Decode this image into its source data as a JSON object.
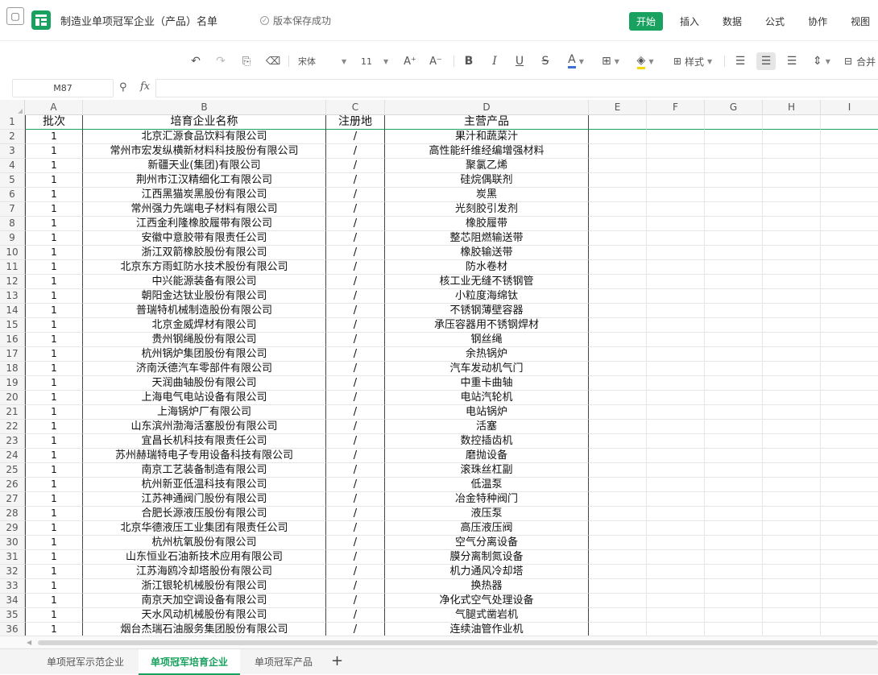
{
  "app": {
    "doc_title": "制造业单项冠军企业（产品）名单",
    "save_status": "版本保存成功",
    "menu": [
      "开始",
      "插入",
      "数据",
      "公式",
      "协作",
      "视图"
    ]
  },
  "toolbar": {
    "font_name": "宋体",
    "font_size": "11",
    "style_label": "样式",
    "merge_label": "合并"
  },
  "formula_bar": {
    "cell_ref": "M87",
    "fx_label": "fx",
    "value": ""
  },
  "columns": [
    "A",
    "B",
    "C",
    "D",
    "E",
    "F",
    "G",
    "H",
    "I"
  ],
  "header_row": {
    "num": "1",
    "cells": [
      "批次",
      "培育企业名称",
      "注册地",
      "主营产品"
    ]
  },
  "rows": [
    {
      "num": "2",
      "cells": [
        "1",
        "北京汇源食品饮料有限公司",
        "/",
        "果汁和蔬菜汁"
      ]
    },
    {
      "num": "3",
      "cells": [
        "1",
        "常州市宏发纵横新材料科技股份有限公司",
        "/",
        "高性能纤维经编增强材料"
      ]
    },
    {
      "num": "4",
      "cells": [
        "1",
        "新疆天业(集团)有限公司",
        "/",
        "聚氯乙烯"
      ]
    },
    {
      "num": "5",
      "cells": [
        "1",
        "荆州市江汉精细化工有限公司",
        "/",
        "硅烷偶联剂"
      ]
    },
    {
      "num": "6",
      "cells": [
        "1",
        "江西黑猫炭黑股份有限公司",
        "/",
        "炭黑"
      ]
    },
    {
      "num": "7",
      "cells": [
        "1",
        "常州强力先端电子材料有限公司",
        "/",
        "光刻胶引发剂"
      ]
    },
    {
      "num": "8",
      "cells": [
        "1",
        "江西金利隆橡胶履带有限公司",
        "/",
        "橡胶履带"
      ]
    },
    {
      "num": "9",
      "cells": [
        "1",
        "安徽中意胶带有限责任公司",
        "/",
        "整芯阻燃输送带"
      ]
    },
    {
      "num": "10",
      "cells": [
        "1",
        "浙江双箭橡胶股份有限公司",
        "/",
        "橡胶输送带"
      ]
    },
    {
      "num": "11",
      "cells": [
        "1",
        "北京东方雨虹防水技术股份有限公司",
        "/",
        "防水卷材"
      ]
    },
    {
      "num": "12",
      "cells": [
        "1",
        "中兴能源装备有限公司",
        "/",
        "核工业无缝不锈钢管"
      ]
    },
    {
      "num": "13",
      "cells": [
        "1",
        "朝阳金达钛业股份有限公司",
        "/",
        "小粒度海绵钛"
      ]
    },
    {
      "num": "14",
      "cells": [
        "1",
        "普瑞特机械制造股份有限公司",
        "/",
        "不锈钢薄壁容器"
      ]
    },
    {
      "num": "15",
      "cells": [
        "1",
        "北京金威焊材有限公司",
        "/",
        "承压容器用不锈钢焊材"
      ]
    },
    {
      "num": "16",
      "cells": [
        "1",
        "贵州钢绳股份有限公司",
        "/",
        "钢丝绳"
      ]
    },
    {
      "num": "17",
      "cells": [
        "1",
        "杭州锅炉集团股份有限公司",
        "/",
        "余热锅炉"
      ]
    },
    {
      "num": "18",
      "cells": [
        "1",
        "济南沃德汽车零部件有限公司",
        "/",
        "汽车发动机气门"
      ]
    },
    {
      "num": "19",
      "cells": [
        "1",
        "天润曲轴股份有限公司",
        "/",
        "中重卡曲轴"
      ]
    },
    {
      "num": "20",
      "cells": [
        "1",
        "上海电气电站设备有限公司",
        "/",
        "电站汽轮机"
      ]
    },
    {
      "num": "21",
      "cells": [
        "1",
        "上海锅炉厂有限公司",
        "/",
        "电站锅炉"
      ]
    },
    {
      "num": "22",
      "cells": [
        "1",
        "山东滨州渤海活塞股份有限公司",
        "/",
        "活塞"
      ]
    },
    {
      "num": "23",
      "cells": [
        "1",
        "宜昌长机科技有限责任公司",
        "/",
        "数控插齿机"
      ]
    },
    {
      "num": "24",
      "cells": [
        "1",
        "苏州赫瑞特电子专用设备科技有限公司",
        "/",
        "磨抛设备"
      ]
    },
    {
      "num": "25",
      "cells": [
        "1",
        "南京工艺装备制造有限公司",
        "/",
        "滚珠丝杠副"
      ]
    },
    {
      "num": "26",
      "cells": [
        "1",
        "杭州新亚低温科技有限公司",
        "/",
        "低温泵"
      ]
    },
    {
      "num": "27",
      "cells": [
        "1",
        "江苏神通阀门股份有限公司",
        "/",
        "冶金特种阀门"
      ]
    },
    {
      "num": "28",
      "cells": [
        "1",
        "合肥长源液压股份有限公司",
        "/",
        "液压泵"
      ]
    },
    {
      "num": "29",
      "cells": [
        "1",
        "北京华德液压工业集团有限责任公司",
        "/",
        "高压液压阀"
      ]
    },
    {
      "num": "30",
      "cells": [
        "1",
        "杭州杭氧股份有限公司",
        "/",
        "空气分离设备"
      ]
    },
    {
      "num": "31",
      "cells": [
        "1",
        "山东恒业石油新技术应用有限公司",
        "/",
        "膜分离制氮设备"
      ]
    },
    {
      "num": "32",
      "cells": [
        "1",
        "江苏海鸥冷却塔股份有限公司",
        "/",
        "机力通风冷却塔"
      ]
    },
    {
      "num": "33",
      "cells": [
        "1",
        "浙江银轮机械股份有限公司",
        "/",
        "换热器"
      ]
    },
    {
      "num": "34",
      "cells": [
        "1",
        "南京天加空调设备有限公司",
        "/",
        "净化式空气处理设备"
      ]
    },
    {
      "num": "35",
      "cells": [
        "1",
        "天水风动机械股份有限公司",
        "/",
        "气腿式凿岩机"
      ]
    },
    {
      "num": "36",
      "cells": [
        "1",
        "烟台杰瑞石油服务集团股份有限公司",
        "/",
        "连续油管作业机"
      ]
    }
  ],
  "sheet_tabs": [
    "单项冠军示范企业",
    "单项冠军培育企业",
    "单项冠军产品"
  ],
  "active_tab": "单项冠军培育企业",
  "colors": {
    "accent": "#19a15f",
    "font_color_bar": "#3a6fd8",
    "fill_color_bar": "#f5d800"
  }
}
